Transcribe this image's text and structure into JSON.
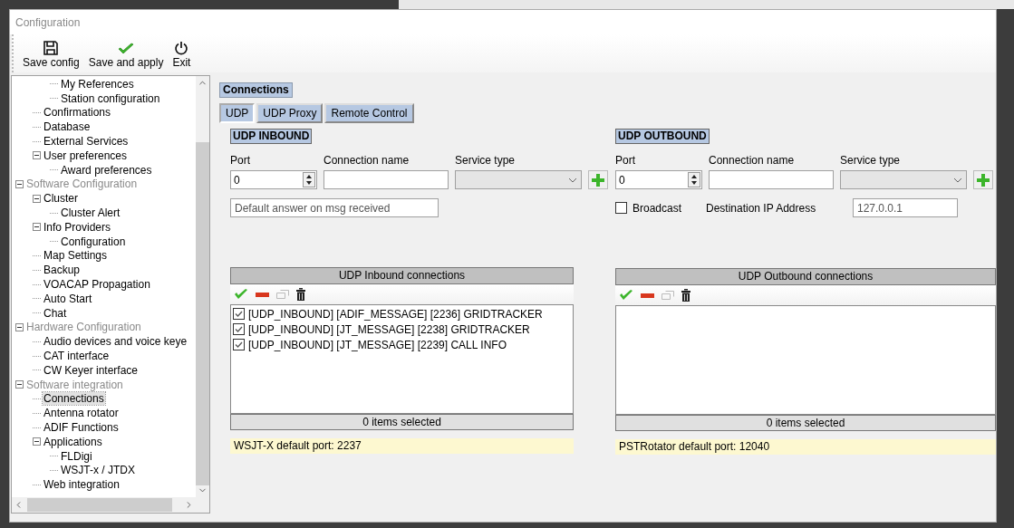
{
  "window": {
    "title": "Configuration"
  },
  "toolbar": [
    {
      "label": "Save config"
    },
    {
      "label": "Save and apply"
    },
    {
      "label": "Exit"
    }
  ],
  "tree": [
    {
      "children": [
        {
          "children": [
            {
              "label": "My References",
              "selected": false
            },
            {
              "label": "Station configuration",
              "selected": false
            }
          ]
        },
        {
          "label": "Confirmations",
          "selected": false
        },
        {
          "label": "Database",
          "selected": false
        },
        {
          "label": "External Services",
          "selected": false
        },
        {
          "label": "User preferences",
          "expanded": true,
          "selected": false,
          "children": [
            {
              "label": "Award preferences",
              "selected": false
            }
          ]
        }
      ]
    },
    {
      "label": "Software Configuration",
      "expanded": true,
      "selected": false,
      "children": [
        {
          "label": "Cluster",
          "expanded": true,
          "selected": false,
          "children": [
            {
              "label": "Cluster Alert",
              "selected": false
            }
          ]
        },
        {
          "label": "Info Providers",
          "expanded": true,
          "selected": false,
          "children": [
            {
              "label": "Configuration",
              "selected": false
            }
          ]
        },
        {
          "label": "Map Settings",
          "selected": false
        },
        {
          "label": "Backup",
          "selected": false
        },
        {
          "label": "VOACAP Propagation",
          "selected": false
        },
        {
          "label": "Auto Start",
          "selected": false
        },
        {
          "label": "Chat",
          "selected": false
        }
      ]
    },
    {
      "label": "Hardware Configuration",
      "expanded": true,
      "selected": false,
      "children": [
        {
          "label": "Audio devices and voice keye",
          "selected": false
        },
        {
          "label": "CAT interface",
          "selected": false
        },
        {
          "label": "CW Keyer interface",
          "selected": false
        }
      ]
    },
    {
      "label": "Software integration",
      "expanded": true,
      "selected": false,
      "children": [
        {
          "label": "Connections",
          "selected": true
        },
        {
          "label": "Antenna rotator",
          "selected": false
        },
        {
          "label": "ADIF Functions",
          "selected": false
        },
        {
          "label": "Applications",
          "expanded": true,
          "selected": false,
          "children": [
            {
              "label": "FLDigi",
              "selected": false
            },
            {
              "label": "WSJT-x / JTDX",
              "selected": false
            }
          ]
        },
        {
          "label": "Web integration",
          "selected": false
        }
      ]
    }
  ],
  "section_title": "Connections",
  "tabs": [
    {
      "label": "UDP",
      "selected": true
    },
    {
      "label": "UDP Proxy",
      "selected": false
    },
    {
      "label": "Remote Control",
      "selected": false
    }
  ],
  "panels": [
    {
      "kind": "inbound",
      "title": "UDP INBOUND",
      "port_label": "Port",
      "port_value": "0",
      "name_label": "Connection name",
      "service_label": "Service type",
      "answer_placeholder": "Default answer on msg received",
      "list_title": "UDP Inbound connections",
      "items": [
        {
          "label": "[UDP_INBOUND] [ADIF_MESSAGE] [2236] GRIDTRACKER",
          "checked": true
        },
        {
          "label": "[UDP_INBOUND] [JT_MESSAGE] [2238] GRIDTRACKER",
          "checked": true
        },
        {
          "label": "[UDP_INBOUND] [JT_MESSAGE] [2239] CALL INFO",
          "checked": true
        }
      ],
      "status": "0 items selected",
      "hint": "WSJT-X default port: 2237"
    },
    {
      "kind": "outbound",
      "title": "UDP OUTBOUND",
      "port_label": "Port",
      "port_value": "0",
      "name_label": "Connection name",
      "service_label": "Service type",
      "broadcast_label": "Broadcast",
      "broadcast_checked": false,
      "dest_label": "Destination IP Address",
      "dest_value": "127.0.0.1",
      "list_title": "UDP Outbound connections",
      "status": "0 items selected",
      "hint": "PSTRotator default port: 12040"
    }
  ]
}
